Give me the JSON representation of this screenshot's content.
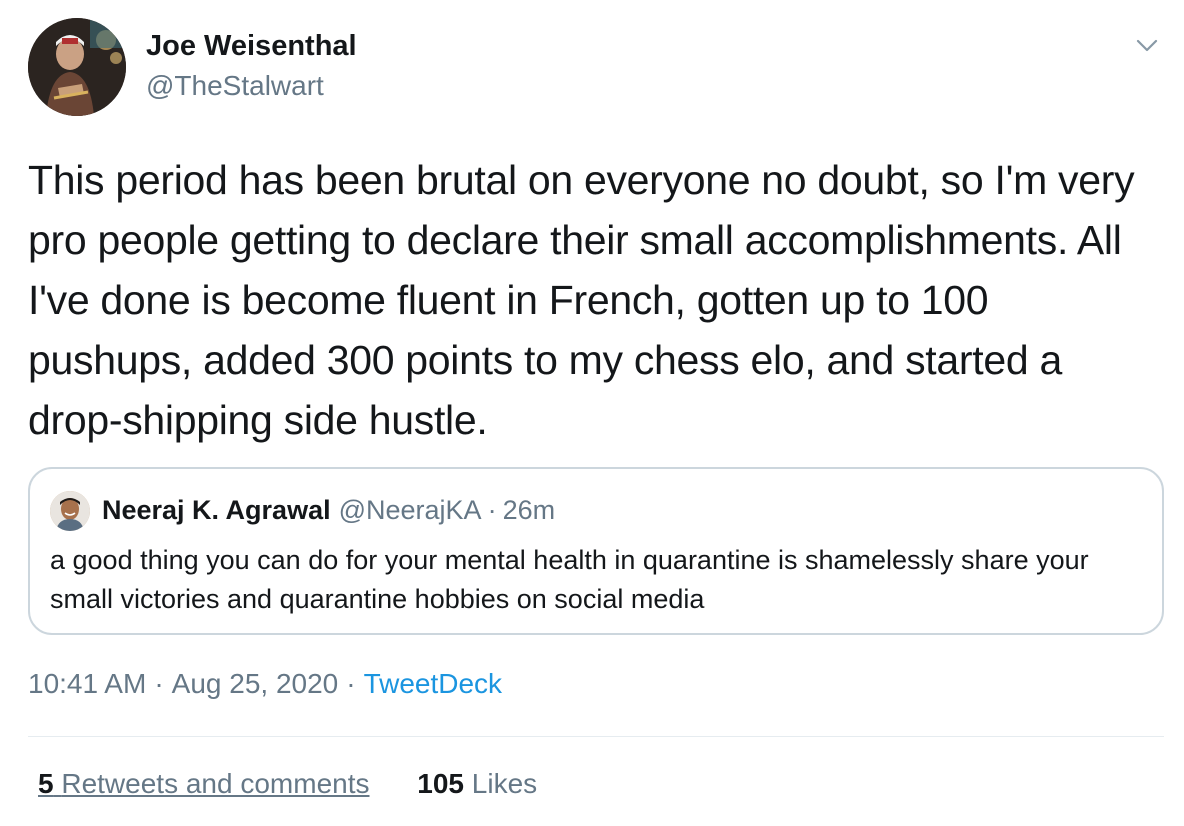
{
  "author": {
    "name": "Joe Weisenthal",
    "handle": "@TheStalwart",
    "avatar_icon": "profile-photo"
  },
  "tweet": {
    "text": "This period has been brutal on everyone no doubt, so I'm very pro people getting to declare their small accomplishments. All I've done is become fluent in French, gotten up to 100 pushups, added 300 points to my chess elo, and started a drop-shipping side hustle."
  },
  "quoted": {
    "name": "Neeraj K. Agrawal",
    "handle": "@NeerajKA",
    "separator": "·",
    "time": "26m",
    "text": "a good thing you can do for your mental health in quarantine is shamelessly share your small victories and quarantine hobbies on social media"
  },
  "meta": {
    "time": "10:41 AM",
    "date": "Aug 25, 2020",
    "source": "TweetDeck",
    "separator": "·"
  },
  "stats": {
    "retweets_count": "5",
    "retweets_label": "Retweets and comments",
    "likes_count": "105",
    "likes_label": "Likes"
  },
  "icons": {
    "more": "chevron-down-icon"
  },
  "colors": {
    "link": "#1b95e0",
    "secondary_text": "#657786",
    "border": "#ccd6dd"
  }
}
